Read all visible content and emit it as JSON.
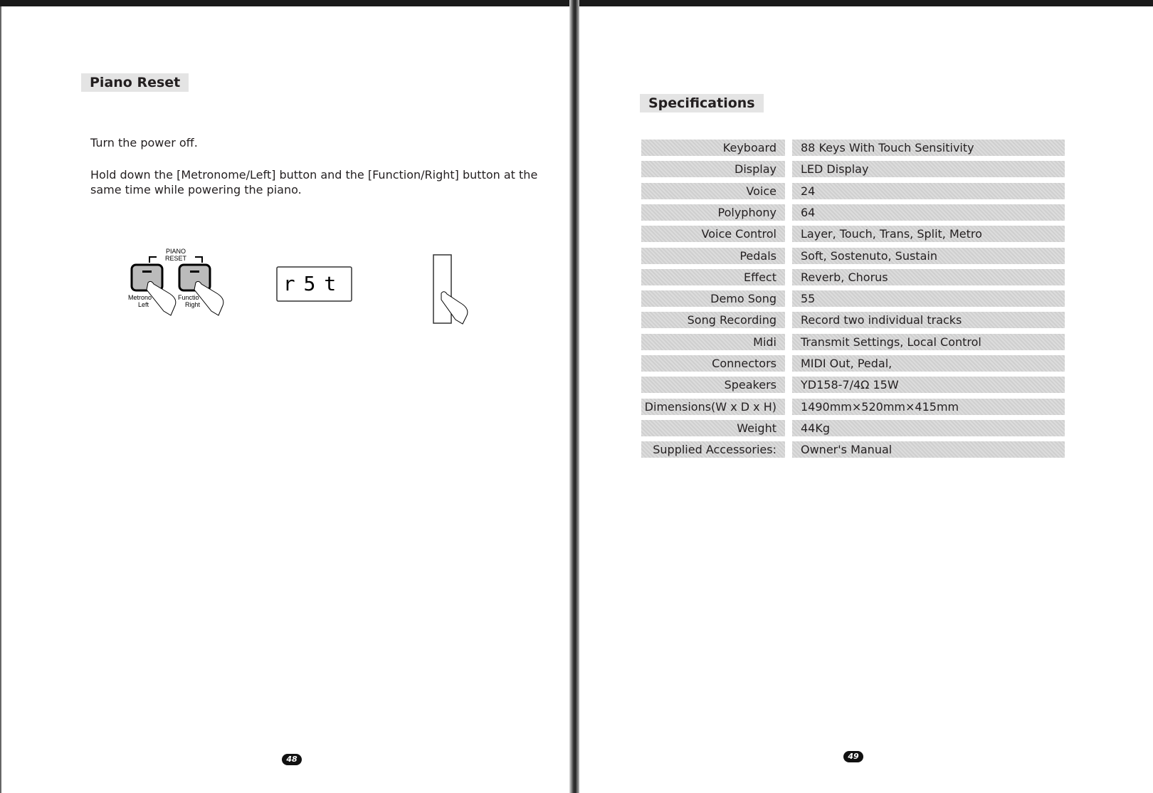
{
  "left_page": {
    "heading": "Piano Reset",
    "paragraphs": [
      "Turn  the power off.",
      "Hold down the [Metronome/Left] button and the [Function/Right] button at the same time while powering the piano."
    ],
    "figure": {
      "bracket_label_1": "PIANO",
      "bracket_label_2": "RESET",
      "button1_label_1": "Metrono",
      "button1_label_2": "Left",
      "button2_label_1": "Functio",
      "button2_label_2": "Right",
      "display_text": "r5t"
    },
    "page_number": "48"
  },
  "right_page": {
    "heading": "Specifications",
    "specs": [
      {
        "label": "Keyboard",
        "value": "88 Keys With Touch Sensitivity"
      },
      {
        "label": "Display",
        "value": "LED Display"
      },
      {
        "label": "Voice",
        "value": "24"
      },
      {
        "label": "Polyphony",
        "value": "64"
      },
      {
        "label": "Voice Control",
        "value": "Layer, Touch, Trans, Split, Metro"
      },
      {
        "label": "Pedals",
        "value": "Soft, Sostenuto, Sustain"
      },
      {
        "label": "Effect",
        "value": "Reverb, Chorus"
      },
      {
        "label": "Demo Song",
        "value": "55"
      },
      {
        "label": "Song Recording",
        "value": "Record two individual tracks"
      },
      {
        "label": "Midi",
        "value": "Transmit Settings,  Local Control"
      },
      {
        "label": "Connectors",
        "value": "MIDI Out, Pedal,"
      },
      {
        "label": "Speakers",
        "value": "YD158-7/4Ω  15W"
      },
      {
        "label": "Dimensions(W x D x H)",
        "value": "1490mm×520mm×415mm"
      },
      {
        "label": "Weight",
        "value": "44Kg"
      },
      {
        "label": "Supplied Accessories:",
        "value": "Owner's Manual"
      }
    ],
    "page_number": "49"
  }
}
